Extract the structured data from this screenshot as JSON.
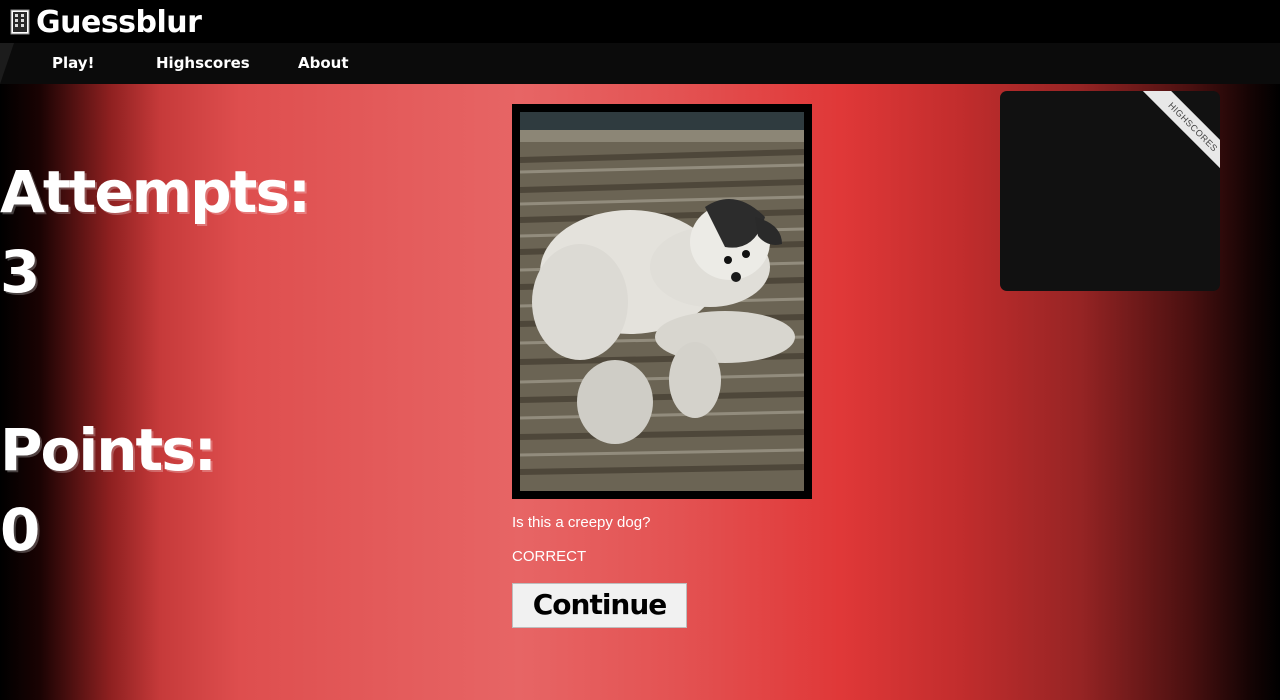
{
  "app": {
    "title": "Guessblur",
    "icon": "building-icon"
  },
  "nav": {
    "items": [
      {
        "label": "Play!"
      },
      {
        "label": "Highscores"
      },
      {
        "label": "About"
      }
    ]
  },
  "stats": {
    "attempts_label": "Attempts:",
    "attempts_value": "3",
    "points_label": "Points:",
    "points_value": "0"
  },
  "game": {
    "question": "Is this a creepy dog?",
    "result": "CORRECT",
    "continue_label": "Continue",
    "image_subject": "white fluffy dog lying on a striped pet bed"
  },
  "highscores": {
    "ribbon_label": "HIGHSCORES"
  },
  "colors": {
    "accent": "#e03838",
    "navbar": "#0b0b0b",
    "panel": "#111111"
  }
}
